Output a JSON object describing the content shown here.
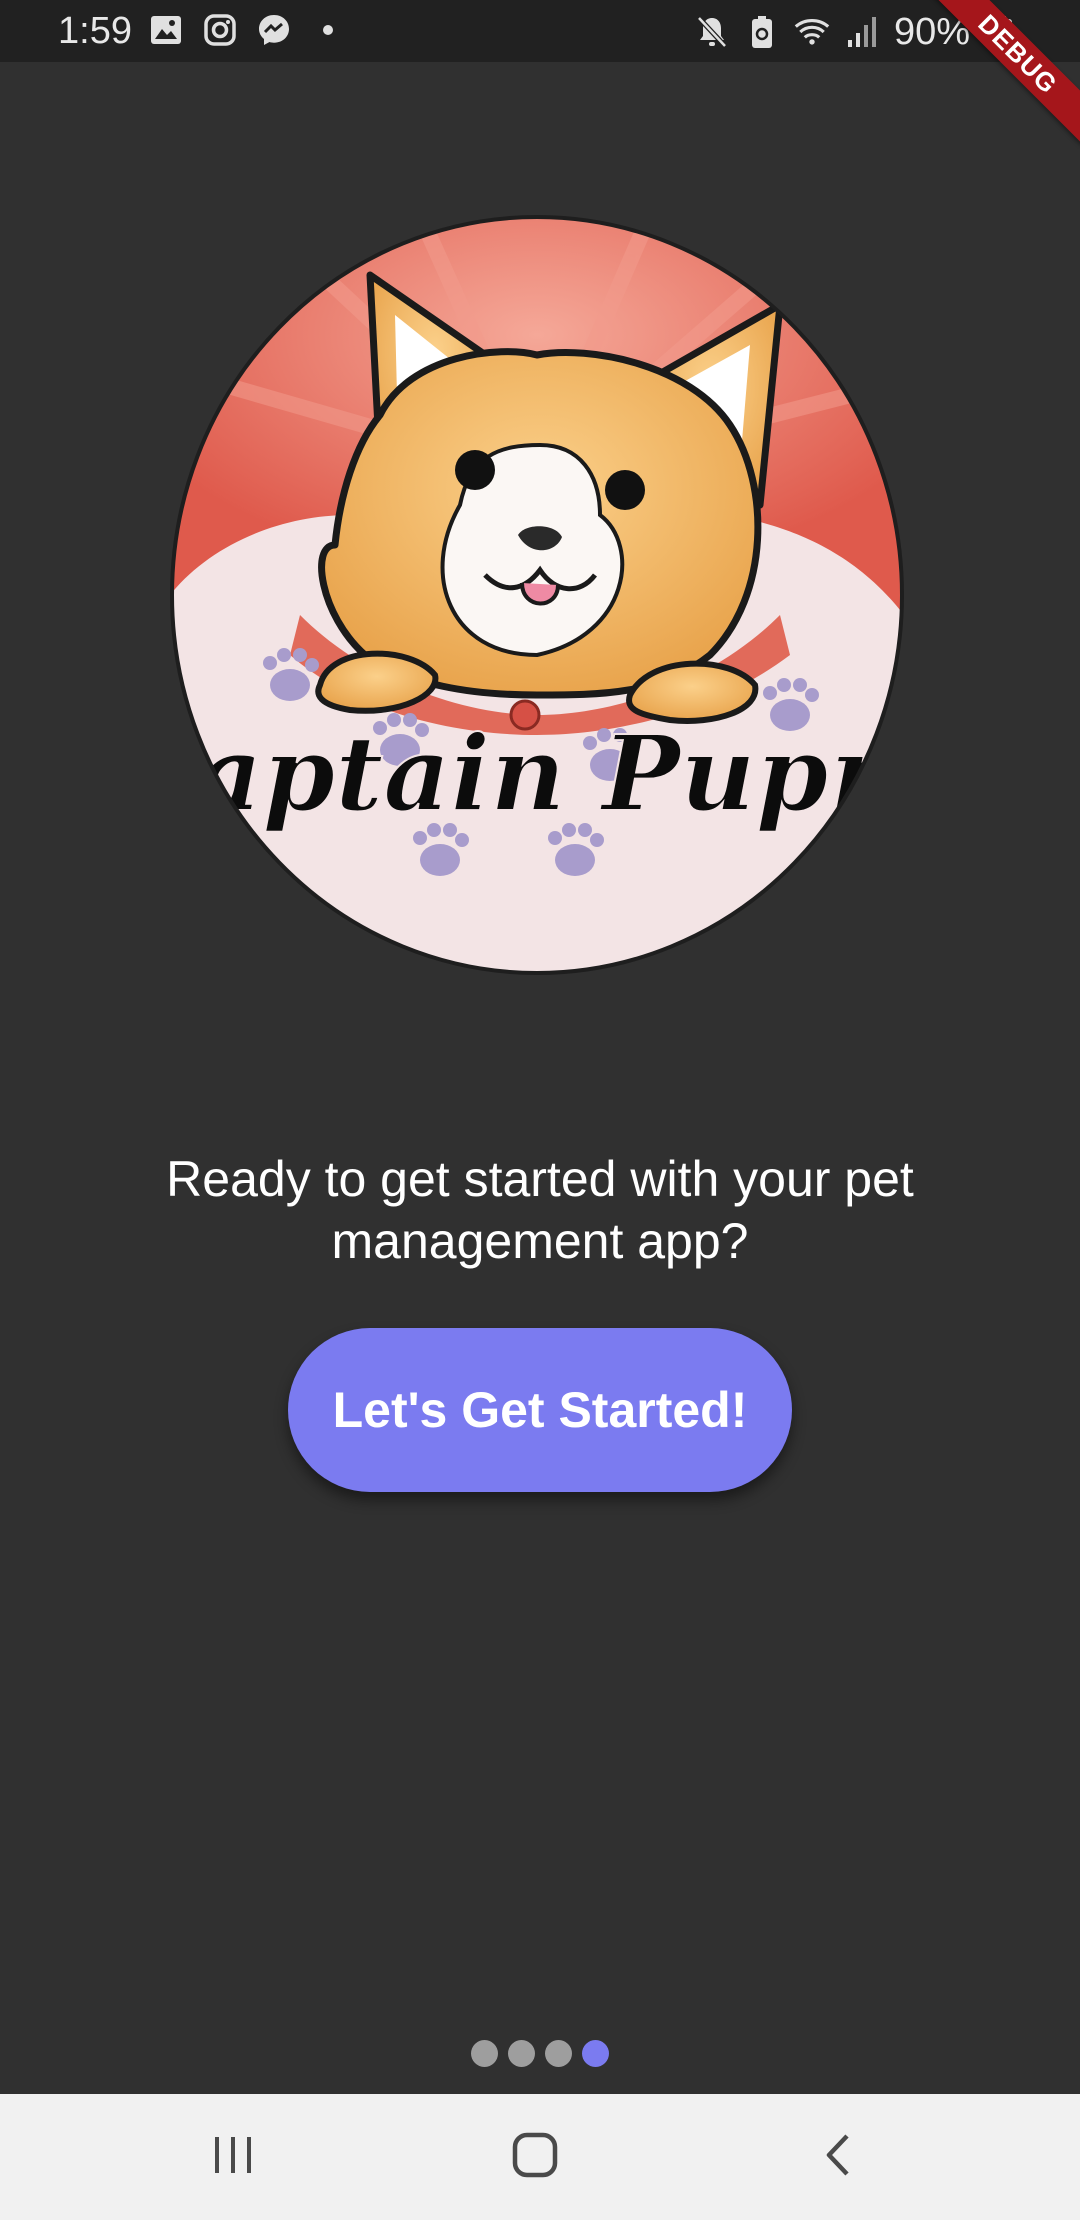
{
  "status_bar": {
    "time": "1:59",
    "battery_percent": "90%",
    "icons_left": [
      "image-icon",
      "instagram-icon",
      "messenger-icon",
      "dot-icon"
    ],
    "icons_right": [
      "mute-icon",
      "battery-saver-icon",
      "wifi-icon",
      "signal-icon",
      "battery-icon"
    ]
  },
  "debug_banner": "DEBUG",
  "logo": {
    "text": "Captain Puppy"
  },
  "onboarding": {
    "prompt": "Ready to get started with your pet management app?",
    "button_label": "Let's Get Started!",
    "page_count": 4,
    "active_page": 4
  },
  "colors": {
    "background": "#303030",
    "accent": "#7b7bf0",
    "status_bar": "#212121",
    "nav_bar": "#f1f1f1",
    "debug_ribbon": "#a5161b"
  },
  "nav_bar": {
    "buttons": [
      "recents-icon",
      "home-icon",
      "back-icon"
    ]
  }
}
